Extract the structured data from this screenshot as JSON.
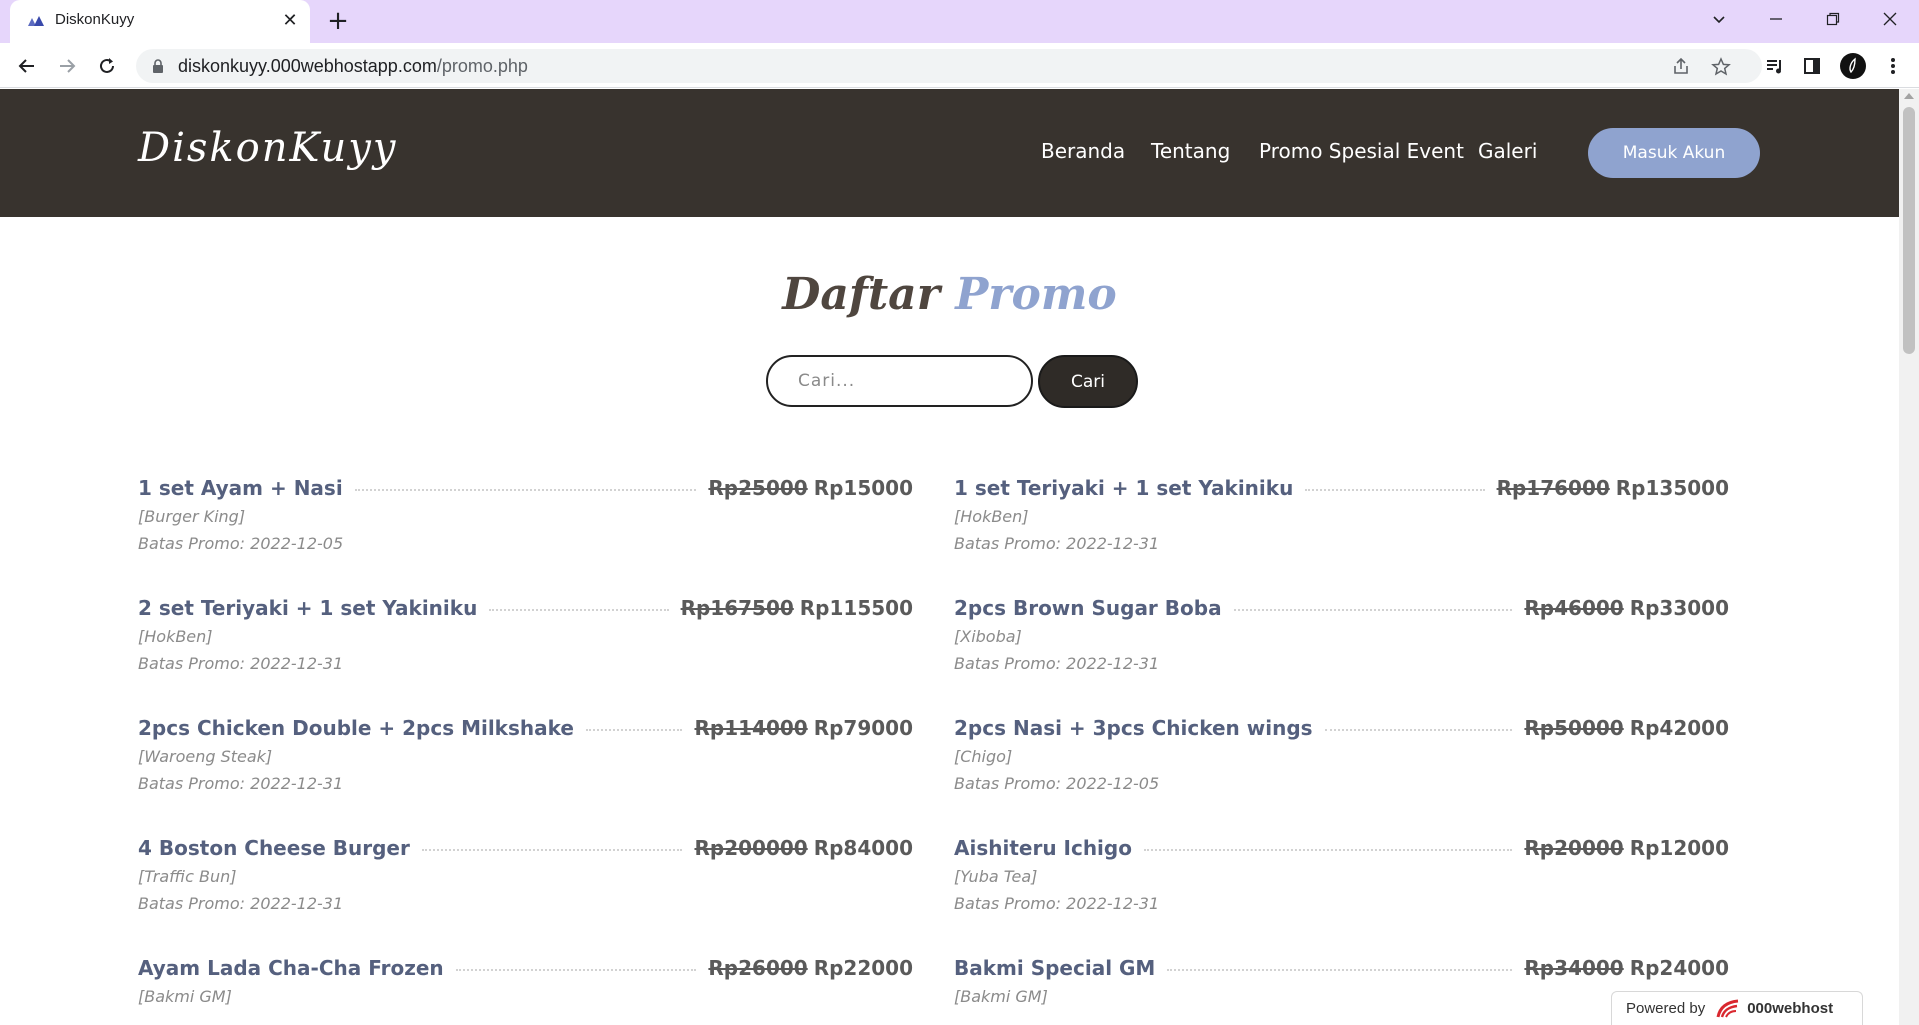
{
  "browser": {
    "tab_title": "DiskonKuyy",
    "url_host": "diskonkuyy.000webhostapp.com",
    "url_path": "/promo.php",
    "icons": [
      "back-icon",
      "forward-icon",
      "reload-icon",
      "lock-icon",
      "share-icon",
      "star-icon",
      "media-icon",
      "sidepanel-icon",
      "profile-icon",
      "menu-icon"
    ]
  },
  "header": {
    "logo": "DiskonKuyy",
    "nav": [
      "Beranda",
      "Tentang",
      "Promo Spesial Event",
      "Galeri"
    ],
    "login_label": "Masuk Akun",
    "colors": {
      "header_bg": "#38332e",
      "accent": "#8fa3cf"
    }
  },
  "page": {
    "title_part1": "Daftar",
    "title_part2": "Promo",
    "search_placeholder": "Cari...",
    "search_button": "Cari"
  },
  "promos": [
    {
      "name": "1 set Ayam + Nasi",
      "old_price": "Rp25000",
      "new_price": "Rp15000",
      "store": "[Burger King]",
      "deadline": "Batas Promo: 2022-12-05"
    },
    {
      "name": "1 set Teriyaki + 1 set Yakiniku",
      "old_price": "Rp176000",
      "new_price": "Rp135000",
      "store": "[HokBen]",
      "deadline": "Batas Promo: 2022-12-31"
    },
    {
      "name": "2 set Teriyaki + 1 set Yakiniku",
      "old_price": "Rp167500",
      "new_price": "Rp115500",
      "store": "[HokBen]",
      "deadline": "Batas Promo: 2022-12-31"
    },
    {
      "name": "2pcs Brown Sugar Boba",
      "old_price": "Rp46000",
      "new_price": "Rp33000",
      "store": "[Xiboba]",
      "deadline": "Batas Promo: 2022-12-31"
    },
    {
      "name": "2pcs Chicken Double + 2pcs Milkshake",
      "old_price": "Rp114000",
      "new_price": "Rp79000",
      "store": "[Waroeng Steak]",
      "deadline": "Batas Promo: 2022-12-31"
    },
    {
      "name": "2pcs Nasi + 3pcs Chicken wings",
      "old_price": "Rp50000",
      "new_price": "Rp42000",
      "store": "[Chigo]",
      "deadline": "Batas Promo: 2022-12-05"
    },
    {
      "name": "4 Boston Cheese Burger",
      "old_price": "Rp200000",
      "new_price": "Rp84000",
      "store": "[Traffic Bun]",
      "deadline": "Batas Promo: 2022-12-31"
    },
    {
      "name": "Aishiteru Ichigo",
      "old_price": "Rp20000",
      "new_price": "Rp12000",
      "store": "[Yuba Tea]",
      "deadline": "Batas Promo: 2022-12-31"
    },
    {
      "name": "Ayam Lada Cha-Cha Frozen",
      "old_price": "Rp26000",
      "new_price": "Rp22000",
      "store": "[Bakmi GM]",
      "deadline": ""
    },
    {
      "name": "Bakmi Special GM",
      "old_price": "Rp34000",
      "new_price": "Rp24000",
      "store": "[Bakmi GM]",
      "deadline": ""
    }
  ],
  "footer_badge": {
    "prefix": "Powered by",
    "brand": "000webhost"
  }
}
